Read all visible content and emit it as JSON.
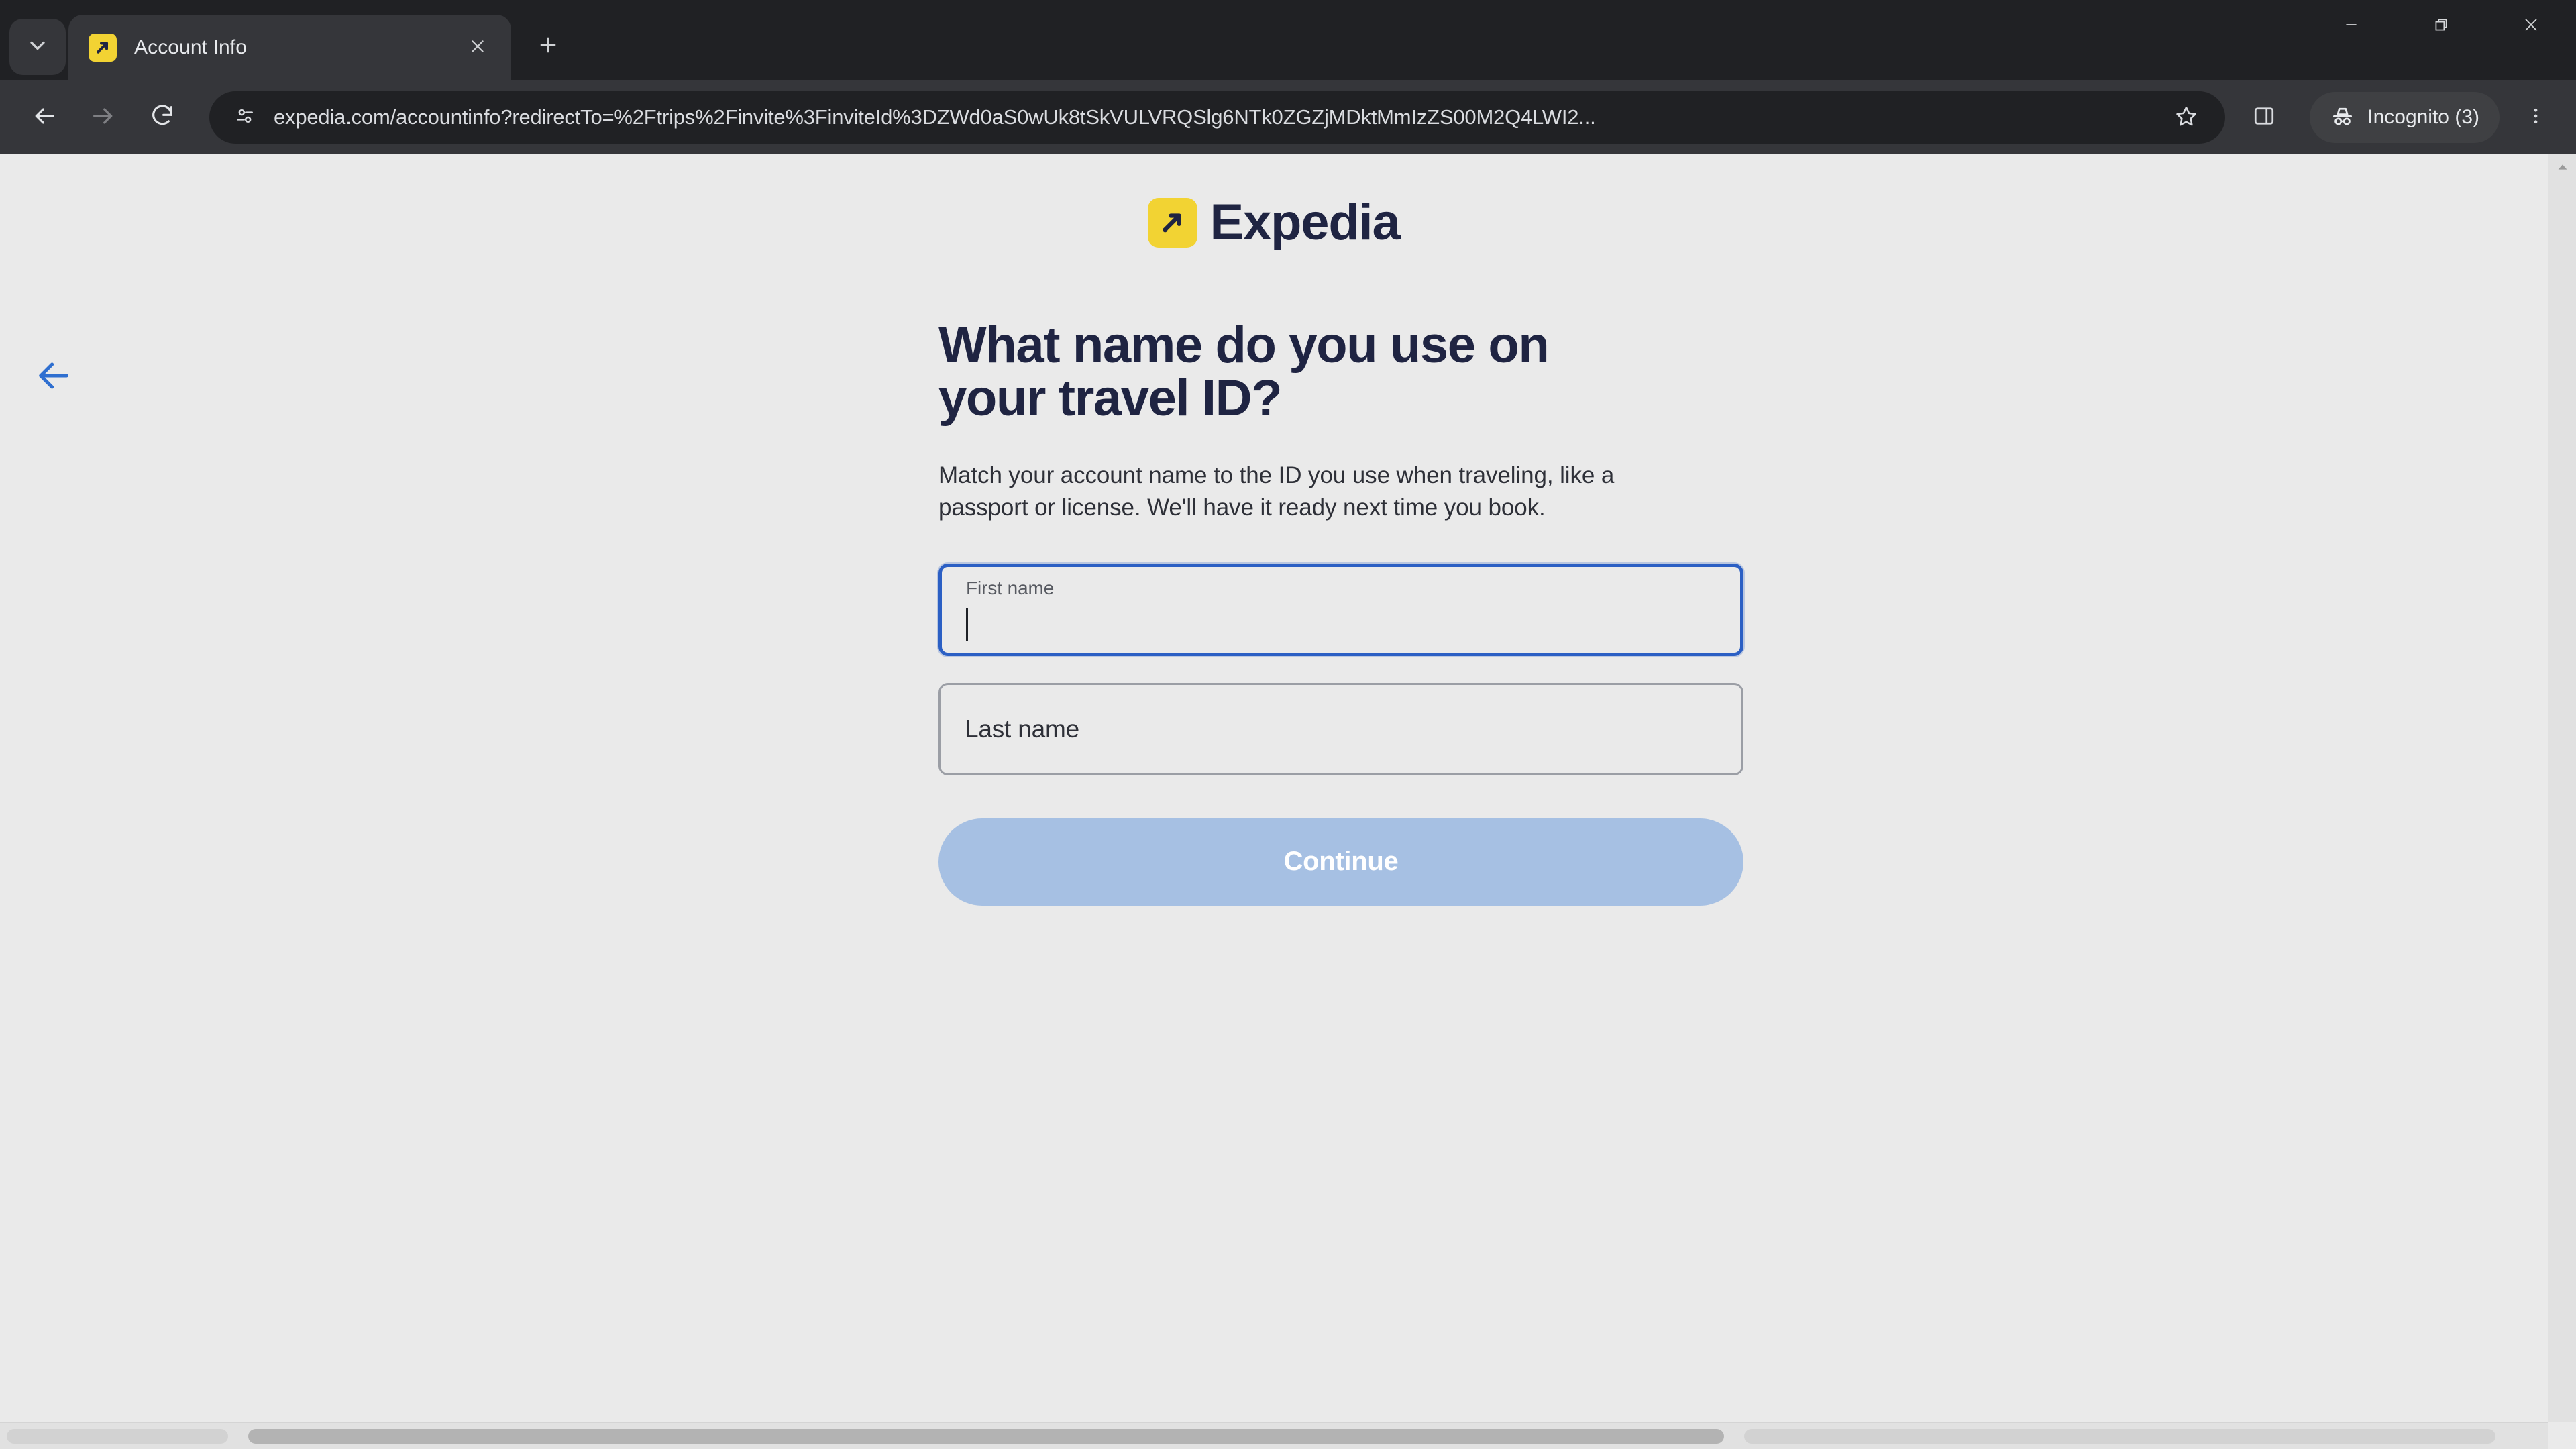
{
  "browser": {
    "tab": {
      "title": "Account Info",
      "favicon_icon": "expedia-arrow-favicon",
      "close_icon": "close-icon"
    },
    "tab_search_icon": "chevron-down-icon",
    "new_tab_icon": "plus-icon",
    "window_controls": {
      "minimize_icon": "minimize-icon",
      "restore_icon": "restore-icon",
      "close_icon": "close-icon"
    },
    "toolbar": {
      "back_icon": "arrow-left-icon",
      "forward_icon": "arrow-right-icon",
      "reload_icon": "reload-icon",
      "site_info_icon": "tune-sliders-icon",
      "url": "expedia.com/accountinfo?redirectTo=%2Ftrips%2Finvite%3FinviteId%3DZWd0aS0wUk8tSkVULVRQSlg6NTk0ZGZjMDktMmIzZS00M2Q4LWI2...",
      "bookmark_icon": "star-icon",
      "side_panel_icon": "side-panel-icon",
      "incognito_icon": "incognito-icon",
      "incognito_label": "Incognito (3)",
      "menu_icon": "three-dots-menu-icon"
    }
  },
  "page": {
    "back_button_icon": "arrow-left-icon",
    "brand": {
      "logo_icon": "expedia-arrow-logo",
      "name": "Expedia"
    },
    "headline": "What name do you use on your travel ID?",
    "subtext": "Match your account name to the ID you use when traveling, like a passport or license. We'll have it ready next time you book.",
    "fields": [
      {
        "name": "first-name",
        "label": "First name",
        "value": "",
        "placeholder": "First name",
        "focused": true
      },
      {
        "name": "last-name",
        "label": "Last name",
        "value": "",
        "placeholder": "Last name",
        "focused": false
      }
    ],
    "continue_label": "Continue",
    "scroll": {
      "up_arrow_icon": "caret-up-icon"
    }
  },
  "colors": {
    "brand_yellow": "#f2d333",
    "brand_navy": "#1f2442",
    "focus_blue": "#2b5fc4",
    "button_disabled_blue": "#a6c0e3",
    "page_background": "#eaeaea",
    "chrome_dark": "#202124",
    "toolbar_dark": "#35363a"
  }
}
